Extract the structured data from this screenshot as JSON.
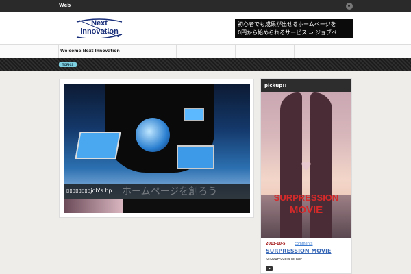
{
  "topbar": {
    "site_label": "Web"
  },
  "header": {
    "logo_line1": "Next",
    "logo_line2": "innovation",
    "banner_line1": "初心者でも成果が出せるホームページを",
    "banner_line2": "0円から始められるサービス ⇒ ジョブペ"
  },
  "nav": {
    "welcome": "Welcome Next Innovation"
  },
  "topics": {
    "badge": "TOPICS"
  },
  "slider": {
    "caption": "▯▯▯▯▯▯▯▯job's hp",
    "caption_overlay": "ホームページを創ろう"
  },
  "pickup": {
    "title": "pickup!!",
    "poster_line1": "SURPRESSION",
    "poster_line2": "MOVIE",
    "date": "2013-10-5",
    "comments": "comments",
    "post_title": "SURPRESSION MOVIE",
    "excerpt": "SURPRESSION MOVIE…"
  },
  "icons": {
    "rss": "rss-icon",
    "more": "arrow-right-icon",
    "heart": "heart-icon"
  }
}
